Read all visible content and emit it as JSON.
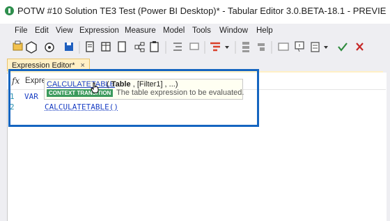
{
  "window": {
    "title": "POTW #10 Solution TE3 Test (Power BI Desktop)* - Tabular Editor 3.0.BETA-18.1 - PREVIE"
  },
  "menu": {
    "items": [
      "File",
      "Edit",
      "View",
      "Expression",
      "Measure",
      "Model",
      "Tools",
      "Window",
      "Help"
    ]
  },
  "toolbar": {
    "icons": [
      "open-icon",
      "model-icon",
      "deploy-icon",
      "save-icon",
      "document-icon",
      "table-icon",
      "new-icon",
      "hierarchy-icon",
      "paste-icon",
      "indent-icon",
      "format-icon",
      "align-icon",
      "stack-icon",
      "window-icon",
      "comment-icon",
      "more-icon",
      "accept-icon",
      "cancel-icon"
    ],
    "accept_color": "#2e8b3e",
    "cancel_color": "#c62828"
  },
  "document_tab": {
    "label": "Expression Editor*",
    "close": "×"
  },
  "editor": {
    "fx_label": "fx",
    "fx_text": "Expre",
    "lines": [
      {
        "number": "1",
        "text": "VAR"
      },
      {
        "number": "2",
        "text": "CALCULATETABLE()"
      }
    ]
  },
  "tooltip": {
    "function_name": "CALCULATETABLE",
    "signature_open": " ( ",
    "signature_param": "Table",
    "signature_rest": " , [Filter1] , ...)",
    "badge": "CONTEXT TRANSITION",
    "description": "The table expression to be evaluated."
  },
  "colors": {
    "highlight_border": "#1565c0",
    "tab_background": "#fff0c6",
    "keyword": "#1a3fc4",
    "badge": "#3b9a5c"
  }
}
